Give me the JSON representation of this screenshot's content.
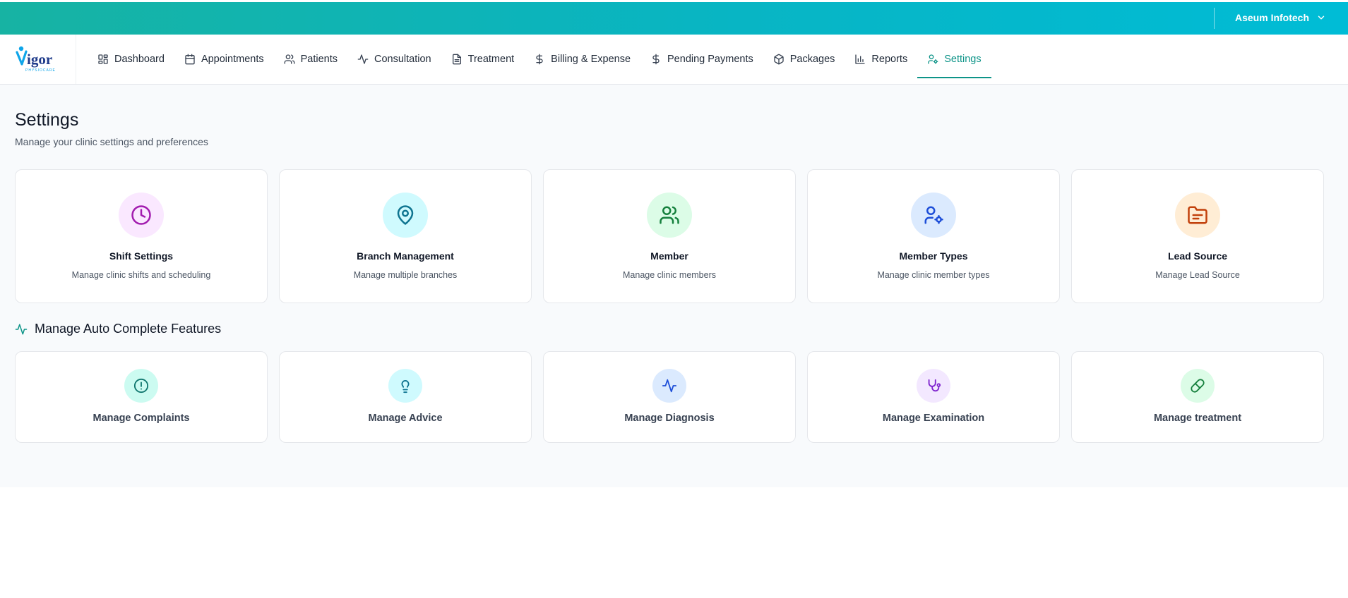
{
  "topbar": {
    "org_name": "Aseum Infotech"
  },
  "logo": {
    "text": "igor",
    "tagline": "PHYSIOCARE"
  },
  "nav": [
    {
      "label": "Dashboard",
      "icon": "dashboard-icon"
    },
    {
      "label": "Appointments",
      "icon": "calendar-icon"
    },
    {
      "label": "Patients",
      "icon": "users-icon"
    },
    {
      "label": "Consultation",
      "icon": "activity-icon"
    },
    {
      "label": "Treatment",
      "icon": "document-icon"
    },
    {
      "label": "Billing & Expense",
      "icon": "dollar-icon"
    },
    {
      "label": "Pending Payments",
      "icon": "dollar-icon"
    },
    {
      "label": "Packages",
      "icon": "package-icon"
    },
    {
      "label": "Reports",
      "icon": "bar-chart-icon"
    },
    {
      "label": "Settings",
      "icon": "user-cog-icon",
      "active": true
    }
  ],
  "page": {
    "title": "Settings",
    "subtitle": "Manage your clinic settings and preferences"
  },
  "settings_cards": [
    {
      "title": "Shift Settings",
      "desc": "Manage clinic shifts and scheduling",
      "icon": "clock-icon",
      "bg": "#fae8ff",
      "color": "#a21caf"
    },
    {
      "title": "Branch Management",
      "desc": "Manage multiple branches",
      "icon": "map-pin-icon",
      "bg": "#cffafe",
      "color": "#0e7490"
    },
    {
      "title": "Member",
      "desc": "Manage clinic members",
      "icon": "users-icon",
      "bg": "#dcfce7",
      "color": "#15803d"
    },
    {
      "title": "Member Types",
      "desc": "Manage clinic member types",
      "icon": "user-cog-icon",
      "bg": "#dbeafe",
      "color": "#1d4ed8"
    },
    {
      "title": "Lead Source",
      "desc": "Manage Lead Source",
      "icon": "folder-icon",
      "bg": "#ffedd5",
      "color": "#c2410c"
    }
  ],
  "section": {
    "title": "Manage Auto Complete Features"
  },
  "autocomplete_cards": [
    {
      "title": "Manage Complaints",
      "icon": "alert-circle-icon",
      "bg": "#ccfbf1",
      "color": "#0f766e"
    },
    {
      "title": "Manage Advice",
      "icon": "lightbulb-icon",
      "bg": "#cffafe",
      "color": "#0e7490"
    },
    {
      "title": "Manage Diagnosis",
      "icon": "activity-icon",
      "bg": "#dbeafe",
      "color": "#1d4ed8"
    },
    {
      "title": "Manage Examination",
      "icon": "stethoscope-icon",
      "bg": "#f3e8ff",
      "color": "#7e22ce"
    },
    {
      "title": "Manage treatment",
      "icon": "pill-icon",
      "bg": "#dcfce7",
      "color": "#15803d"
    }
  ]
}
